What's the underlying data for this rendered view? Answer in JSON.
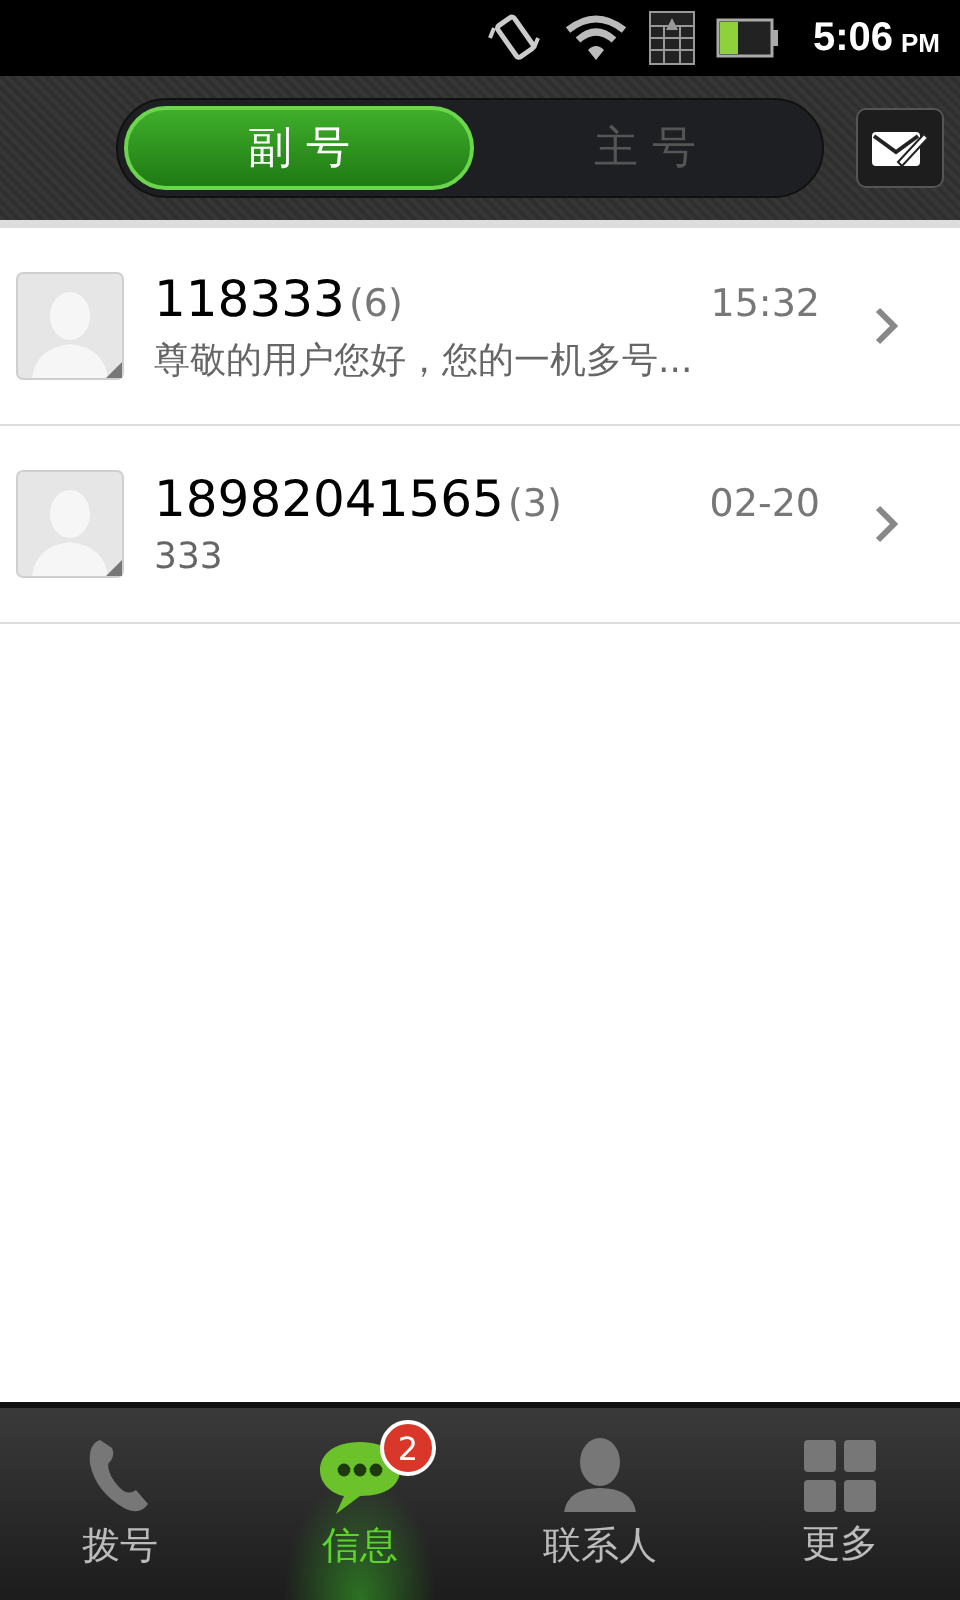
{
  "status_bar": {
    "time": "5:06",
    "ampm": "PM"
  },
  "segments": [
    {
      "label": "副 号",
      "selected": true
    },
    {
      "label": "主 号",
      "selected": false
    }
  ],
  "conversations": [
    {
      "name": "118333",
      "count": "(6)",
      "time": "15:32",
      "preview": "尊敬的用户您好，您的一机多号..."
    },
    {
      "name": "18982041565",
      "count": "(3)",
      "time": "02-20",
      "preview": "333"
    }
  ],
  "nav": [
    {
      "kind": "phone",
      "label": "拨号",
      "selected": false
    },
    {
      "kind": "message",
      "label": "信息",
      "selected": true,
      "badge": "2"
    },
    {
      "kind": "contact",
      "label": "联系人",
      "selected": false
    },
    {
      "kind": "more",
      "label": "更多",
      "selected": false
    }
  ]
}
